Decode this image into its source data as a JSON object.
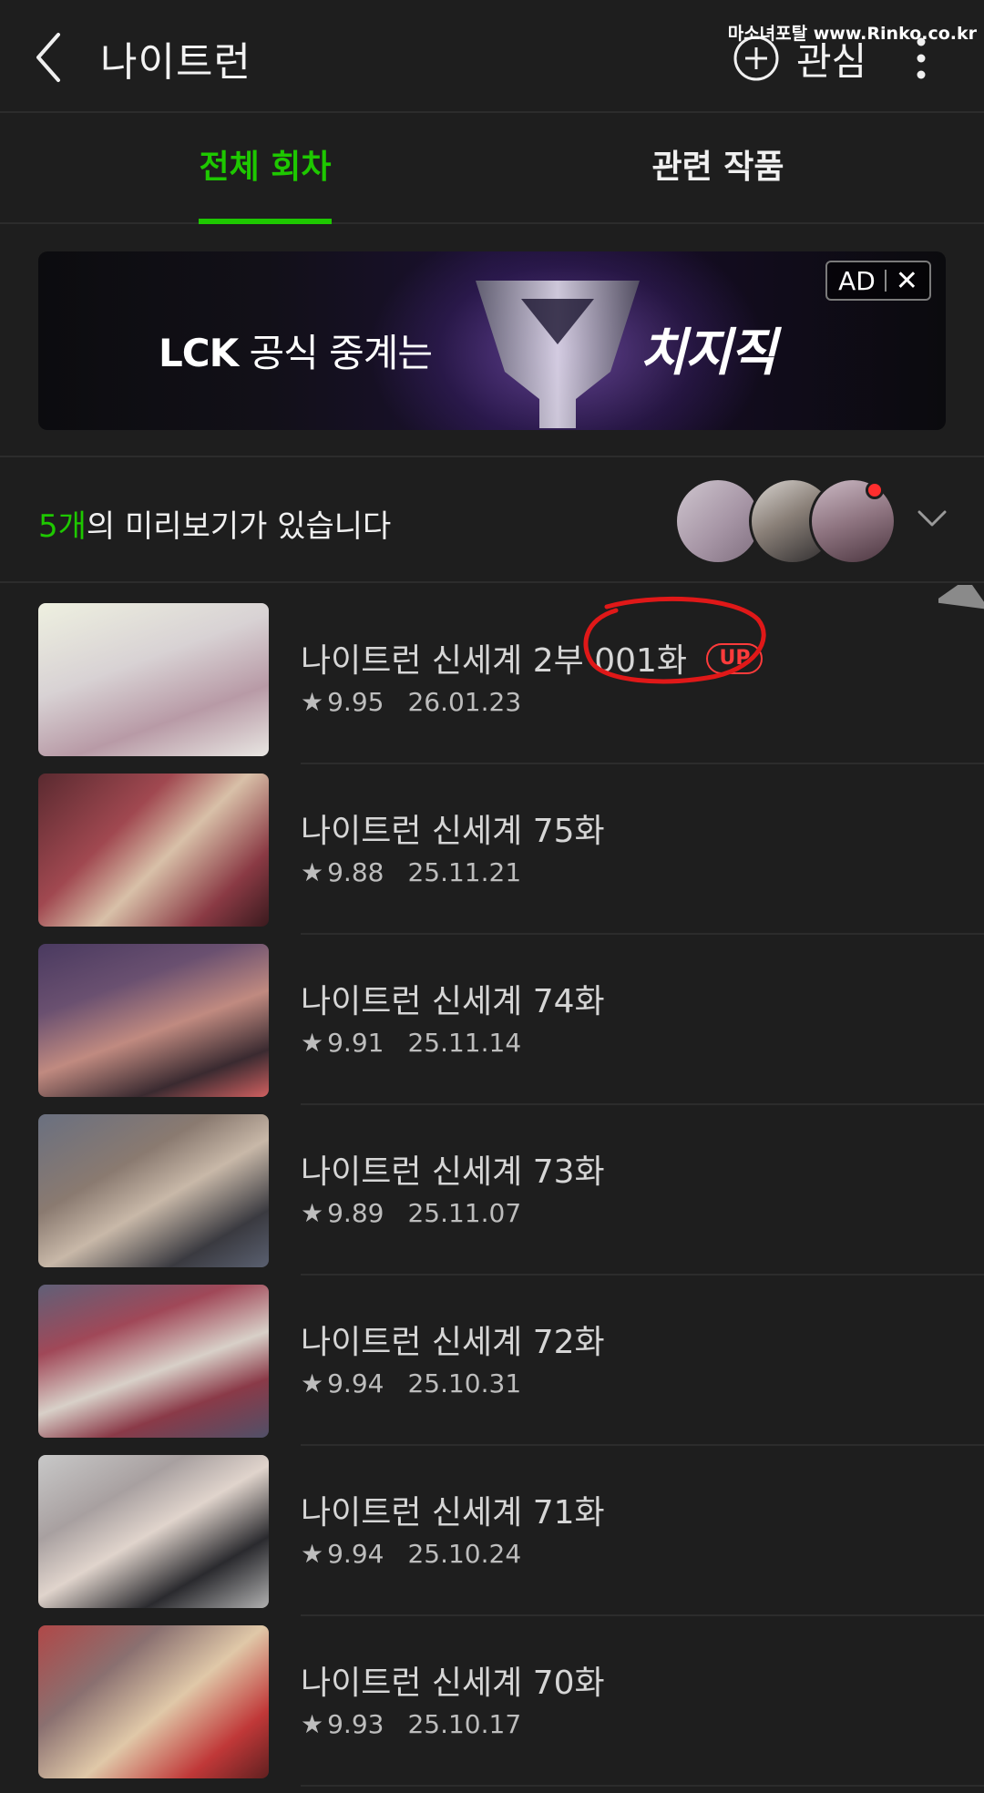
{
  "header": {
    "title": "나이트런",
    "follow_label": "관심",
    "watermark": "마소녀포탈 www.Rinko.co.kr"
  },
  "tabs": [
    {
      "label": "전체 회차",
      "active": true
    },
    {
      "label": "관련 작품",
      "active": false
    }
  ],
  "ad": {
    "text_bold": "LCK",
    "text_rest": " 공식 중계는",
    "brand": "치지직",
    "badge": "AD",
    "close": "✕"
  },
  "preview": {
    "count": "5개",
    "text": "의 미리보기가 있습니다"
  },
  "episodes": [
    {
      "title": "나이트런 신세계 2부 001화",
      "badge": "UP",
      "rating": "9.95",
      "date": "26.01.23"
    },
    {
      "title": "나이트런 신세계 75화",
      "rating": "9.88",
      "date": "25.11.21"
    },
    {
      "title": "나이트런 신세계 74화",
      "rating": "9.91",
      "date": "25.11.14"
    },
    {
      "title": "나이트런 신세계 73화",
      "rating": "9.89",
      "date": "25.11.07"
    },
    {
      "title": "나이트런 신세계 72화",
      "rating": "9.94",
      "date": "25.10.31"
    },
    {
      "title": "나이트런 신세계 71화",
      "rating": "9.94",
      "date": "25.10.24"
    },
    {
      "title": "나이트런 신세계 70화",
      "rating": "9.93",
      "date": "25.10.17"
    }
  ],
  "colors": {
    "accent": "#1ec800",
    "background": "#1e1e1e",
    "up_badge": "#ff3b3b"
  },
  "icons": [
    "back-arrow-icon",
    "plus-circle-icon",
    "more-vertical-icon",
    "chevron-down-icon",
    "star-icon"
  ]
}
